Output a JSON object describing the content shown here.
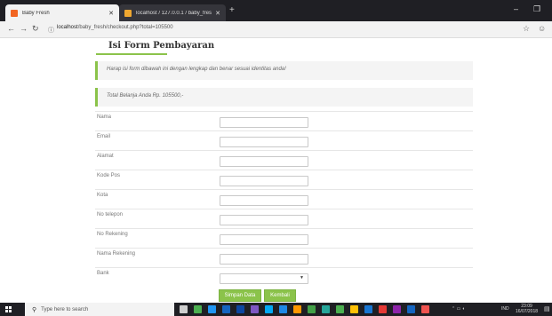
{
  "browser": {
    "tabs": [
      {
        "label": "Baby Fresh",
        "active": true,
        "favicon_color": "#f26522"
      },
      {
        "label": "localhost / 127.0.0.1 / baby_fres",
        "active": false,
        "favicon_color": "#f0a830"
      }
    ],
    "new_tab": "+",
    "url_host": "localhost",
    "url_path": "/baby_fresh/checkout.php?total=105500",
    "window_controls": {
      "minimize": "–",
      "maximize": "❐"
    }
  },
  "page": {
    "title": "Isi Form Pembayaran",
    "notice_1": "Harap isi form dibawah ini dengan lengkap dan benar sesuai identitas anda!",
    "notice_2": "Total Belanja Anda Rp. 105500,-",
    "fields": [
      {
        "label": "Nama"
      },
      {
        "label": "Email"
      },
      {
        "label": "Alamat"
      },
      {
        "label": "Kode Pos"
      },
      {
        "label": "Kota"
      },
      {
        "label": "No telepon"
      },
      {
        "label": "No Rekening"
      },
      {
        "label": "Nama Rekening"
      },
      {
        "label": "Bank"
      }
    ],
    "bank_select_value": "",
    "buttons": {
      "save": "Simpan Data",
      "back": "Kembali"
    }
  },
  "taskbar": {
    "search_placeholder": "Type here to search",
    "tray_language": "IND",
    "tray_time": "23:09",
    "tray_date": "16/07/2018"
  },
  "colors": {
    "accent": "#8bc34a",
    "chrome_dark": "#1f1f24",
    "notice_bg": "#f4f4f4"
  }
}
